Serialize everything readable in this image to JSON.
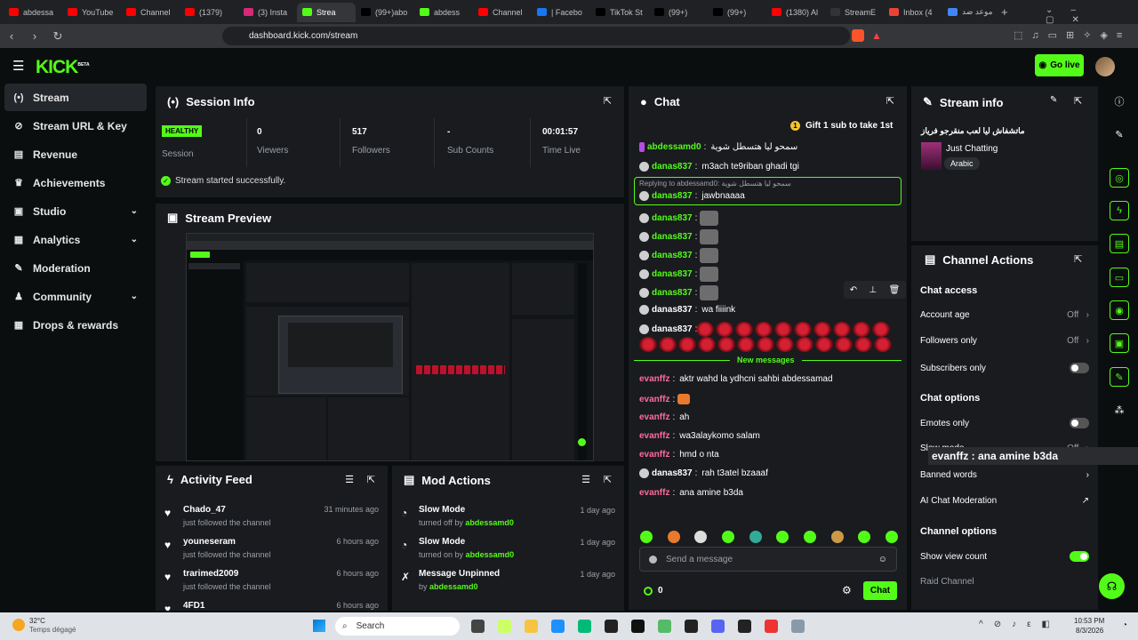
{
  "browser": {
    "tabs": [
      {
        "label": "abdessa",
        "color": "#ff0000"
      },
      {
        "label": "YouTube",
        "color": "#ff0000"
      },
      {
        "label": "Channel",
        "color": "#ff0000"
      },
      {
        "label": "(1379)",
        "color": "#ff0000"
      },
      {
        "label": "(3) Insta",
        "color": "#d62976"
      },
      {
        "label": "Strea",
        "color": "#53fc18",
        "active": true
      },
      {
        "label": "(99+)abo",
        "color": "#000000"
      },
      {
        "label": "abdess",
        "color": "#53fc18"
      },
      {
        "label": "Channel",
        "color": "#ff0000"
      },
      {
        "label": "| Facebo",
        "color": "#1877f2"
      },
      {
        "label": "TikTok St",
        "color": "#000000"
      },
      {
        "label": "(99+)",
        "color": "#000000"
      },
      {
        "label": "(99+)",
        "color": "#000000"
      },
      {
        "label": "(1380) Al",
        "color": "#ff0000"
      },
      {
        "label": "StreamE",
        "color": "#333333"
      },
      {
        "label": "Inbox (4",
        "color": "#ea4335"
      },
      {
        "label": "موعد ضد",
        "color": "#4285f4"
      }
    ],
    "url": "dashboard.kick.com/stream"
  },
  "header": {
    "logo": "KICK",
    "logo_tag": "BETA",
    "go_live": "Go live"
  },
  "sidebar": {
    "items": [
      {
        "label": "Stream",
        "icon": "broadcast-icon",
        "active": true
      },
      {
        "label": "Stream URL & Key",
        "icon": "link-icon"
      },
      {
        "label": "Revenue",
        "icon": "chart-icon"
      },
      {
        "label": "Achievements",
        "icon": "trophy-icon"
      },
      {
        "label": "Studio",
        "icon": "studio-icon",
        "chevron": true
      },
      {
        "label": "Analytics",
        "icon": "analytics-icon",
        "chevron": true
      },
      {
        "label": "Moderation",
        "icon": "wrench-icon"
      },
      {
        "label": "Community",
        "icon": "people-icon",
        "chevron": true
      },
      {
        "label": "Drops & rewards",
        "icon": "gift-icon"
      }
    ]
  },
  "session": {
    "title": "Session Info",
    "health": "HEALTHY",
    "session_label": "Session",
    "viewers_value": "0",
    "viewers_label": "Viewers",
    "followers_value": "517",
    "followers_label": "Followers",
    "subs_value": "-",
    "subs_label": "Sub Counts",
    "time_value": "00:01:57",
    "time_label": "Time Live",
    "status": "Stream started successfully."
  },
  "preview": {
    "title": "Stream Preview"
  },
  "activity": {
    "title": "Activity Feed",
    "items": [
      {
        "name": "Chado_47",
        "text": "just followed the channel",
        "time": "31 minutes ago"
      },
      {
        "name": "youneseram",
        "text": "just followed the channel",
        "time": "6 hours ago"
      },
      {
        "name": "trarimed2009",
        "text": "just followed the channel",
        "time": "6 hours ago"
      },
      {
        "name": "4FD1",
        "text": "",
        "time": "6 hours ago"
      }
    ]
  },
  "mod": {
    "title": "Mod Actions",
    "items": [
      {
        "action": "Slow Mode",
        "detail": "turned off by",
        "by": "abdessamd0",
        "time": "1 day ago"
      },
      {
        "action": "Slow Mode",
        "detail": "turned on by",
        "by": "abdessamd0",
        "time": "1 day ago"
      },
      {
        "action": "Message Unpinned",
        "detail": "by",
        "by": "abdessamd0",
        "time": "1 day ago"
      }
    ]
  },
  "chat": {
    "title": "Chat",
    "gift": "Gift 1 sub to take 1st",
    "reply_text": "Replying to abdessamd0: سمحو ليا هتسطل شوية",
    "new_messages": "New messages",
    "messages": [
      {
        "user": "abdessamd0",
        "text": "سمحو ليا هتسطل شوية",
        "style": "green"
      },
      {
        "user": "danas837",
        "text": "m3ach te9riban ghadi tgi",
        "style": "green"
      },
      {
        "user": "danas837",
        "text": "jawbnaaaa",
        "style": "green"
      },
      {
        "user": "danas837",
        "text": "",
        "style": "green"
      },
      {
        "user": "danas837",
        "text": "",
        "style": "green"
      },
      {
        "user": "danas837",
        "text": "",
        "style": "green"
      },
      {
        "user": "danas837",
        "text": "",
        "style": "green"
      },
      {
        "user": "danas837",
        "text": "",
        "style": "green"
      },
      {
        "user": "danas837",
        "text": "wa fiiiink",
        "style": "white"
      },
      {
        "user": "danas837",
        "text": "",
        "style": "white"
      },
      {
        "user": "evanffz",
        "text": "aktr wahd la ydhcni sahbi abdessamad",
        "style": "pink"
      },
      {
        "user": "evanffz",
        "text": "",
        "style": "pink"
      },
      {
        "user": "evanffz",
        "text": "ah",
        "style": "pink"
      },
      {
        "user": "evanffz",
        "text": "wa3alaykomo salam",
        "style": "pink"
      },
      {
        "user": "evanffz",
        "text": "hmd o nta",
        "style": "pink"
      },
      {
        "user": "danas837",
        "text": "rah t3atel bzaaaf",
        "style": "white"
      },
      {
        "user": "evanffz",
        "text": "ana amine b3da",
        "style": "pink"
      }
    ],
    "input_placeholder": "Send a message",
    "points": "0",
    "send": "Chat"
  },
  "stream_info": {
    "title": "Stream info",
    "stream_title": "ماتشفاش ليا لعب منقرجو فرياز",
    "category": "Just Chatting",
    "tag": "Arabic"
  },
  "channel_actions": {
    "title": "Channel Actions",
    "chat_access": "Chat access",
    "account_age": "Account age",
    "account_age_value": "Off",
    "followers_only": "Followers only",
    "followers_only_value": "Off",
    "subscribers_only": "Subscribers only",
    "chat_options": "Chat options",
    "emotes_only": "Emotes only",
    "slow_mode": "Slow mode",
    "slow_mode_value": "Off",
    "banned_words": "Banned words",
    "ai_chat": "AI Chat Moderation",
    "channel_options": "Channel options",
    "show_view_count": "Show view count",
    "raid_channel": "Raid Channel"
  },
  "overlay_text": "evanffz : ana amine b3da",
  "taskbar": {
    "temp": "32°C",
    "weather": "Temps dégagé",
    "search": "Search",
    "time": "10:53 PM",
    "date": "8/3/2026"
  }
}
